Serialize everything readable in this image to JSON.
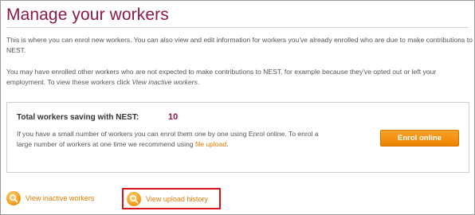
{
  "page": {
    "title": "Manage your workers"
  },
  "intro": {
    "paragraph1": "This is where you can enrol new workers. You can also view and edit information for workers you've already enrolled who are due to make contributions to NEST.",
    "paragraph2_prefix": "You may have enrolled other workers who are not expected to make contributions to NEST, for example because they've opted out or left your employment. To view these workers click ",
    "paragraph2_link": "View inactive workers",
    "paragraph2_suffix": "."
  },
  "summary": {
    "label": "Total workers saving with NEST:",
    "count": "10",
    "text_prefix": "If you have a small number of workers you can enrol them one by one using Enrol online. To enrol a large number of workers at one time we recommend using ",
    "text_link": "file upload",
    "text_suffix": ".",
    "enrol_button": "Enrol online"
  },
  "links": {
    "inactive": "View inactive workers",
    "upload_history": "View upload history",
    "icon": "magnifier-icon"
  },
  "colors": {
    "title": "#8b1a4a",
    "accent": "#e07b00",
    "button": "#ee8200",
    "highlight_border": "#d9141a"
  }
}
